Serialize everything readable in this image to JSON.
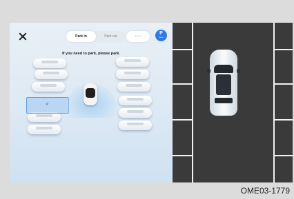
{
  "header": {
    "close_icon": "close-icon",
    "mode_tabs": [
      {
        "label": "Park in",
        "active": true
      },
      {
        "label": "Park out",
        "active": false
      }
    ],
    "view_button_label": "· · ·",
    "park_badge": {
      "letter": "P",
      "caption": "Auto"
    }
  },
  "hint_text": "If you need to park, please park.",
  "slot_marker": "P",
  "figure_code": "OME03-1779",
  "colors": {
    "accent": "#2f7ae5",
    "slot_highlight": "#5aa0e6",
    "asphalt": "#3a3a3a"
  }
}
